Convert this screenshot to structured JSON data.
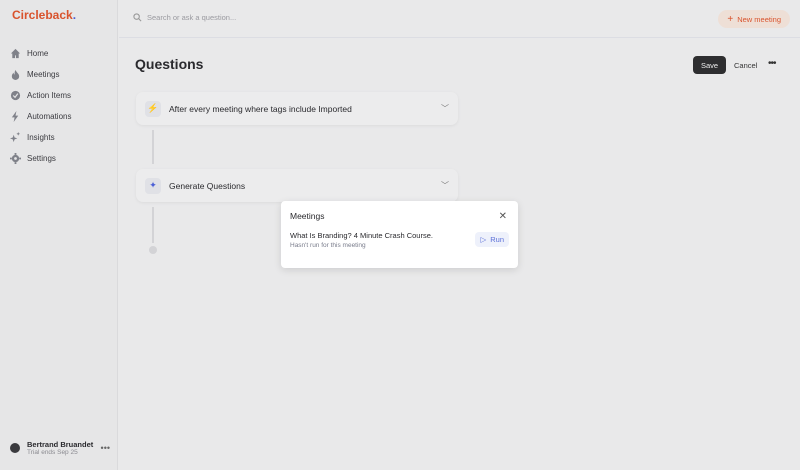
{
  "app": {
    "logo": "Circleback",
    "logo_dot": "."
  },
  "sidebar": {
    "items": [
      {
        "label": "Home",
        "icon": "home-icon"
      },
      {
        "label": "Meetings",
        "icon": "flame-icon"
      },
      {
        "label": "Action Items",
        "icon": "check-circle-icon"
      },
      {
        "label": "Automations",
        "icon": "bolt-icon"
      },
      {
        "label": "Insights",
        "icon": "sparkles-icon"
      },
      {
        "label": "Settings",
        "icon": "gear-icon"
      }
    ],
    "user": {
      "name": "Bertrand Bruandet",
      "trial": "Trial ends Sep 25",
      "more": "•••"
    }
  },
  "topbar": {
    "search_placeholder": "Search or ask a question...",
    "new_meeting": "New meeting",
    "plus": "+"
  },
  "main": {
    "title": "Questions",
    "save": "Save",
    "cancel": "Cancel",
    "more": "•••",
    "steps": [
      {
        "label": "After every meeting where tags include Imported",
        "icon": "bolt-icon"
      },
      {
        "label": "Generate Questions",
        "icon": "sparkles-icon"
      }
    ]
  },
  "modal": {
    "title": "Meetings",
    "close": "✕",
    "meeting_name": "What Is Branding? 4 Minute Crash Course.",
    "meeting_status": "Hasn't run for this meeting",
    "run": "Run",
    "run_icon": "▷"
  },
  "colors": {
    "brand": "#d9532d",
    "accent": "#4b5fd6"
  }
}
